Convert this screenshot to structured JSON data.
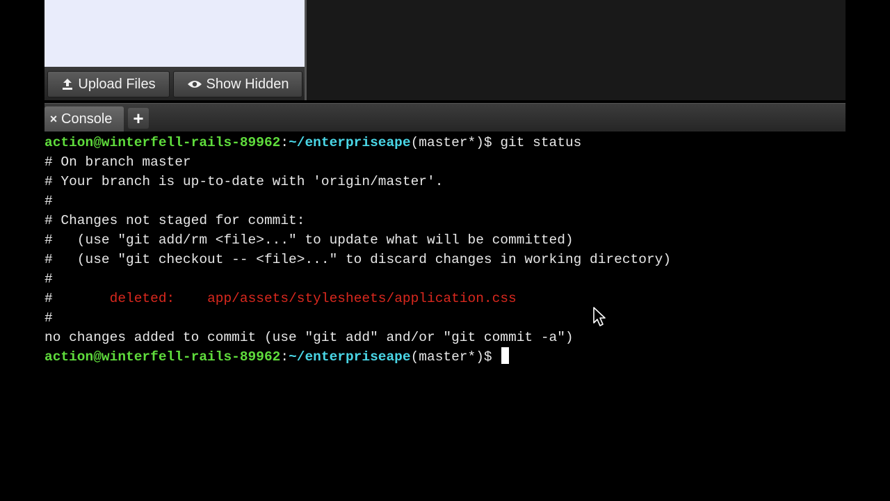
{
  "files": {
    "upload_label": "Upload Files",
    "upload_icon": "upload-icon",
    "show_hidden_label": "Show Hidden",
    "show_hidden_icon": "eye-icon"
  },
  "tabs": {
    "console_label": "Console",
    "close_glyph": "×",
    "add_glyph": "+"
  },
  "terminal": {
    "prompt": {
      "user_host": "action@winterfell-rails-89962",
      "colon": ":",
      "path": "~/enterpriseape",
      "branch": "(master*)$ "
    },
    "command": "git status",
    "lines": [
      "# On branch master",
      "# Your branch is up-to-date with 'origin/master'.",
      "#",
      "# Changes not staged for commit:",
      "#   (use \"git add/rm <file>...\" to update what will be committed)",
      "#   (use \"git checkout -- <file>...\" to discard changes in working directory)",
      "#",
      "#",
      "no changes added to commit (use \"git add\" and/or \"git commit -a\")"
    ],
    "deleted_prefix": "#       ",
    "deleted_label": "deleted:    ",
    "deleted_file": "app/assets/stylesheets/application.css"
  },
  "colors": {
    "prompt_user": "#5fdc3c",
    "prompt_path": "#4ad6e6",
    "deleted": "#d9281e"
  }
}
